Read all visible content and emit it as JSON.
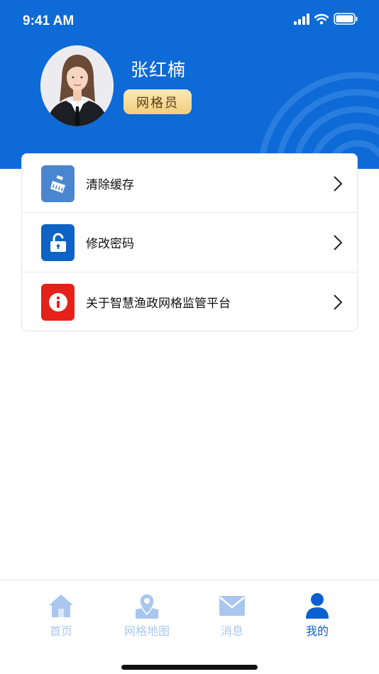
{
  "status_bar": {
    "time": "9:41 AM"
  },
  "profile": {
    "name": "张红楠",
    "role": "网格员"
  },
  "menu": {
    "items": [
      {
        "label": "清除缓存",
        "icon": "broom-icon",
        "color": "#4a86d0"
      },
      {
        "label": "修改密码",
        "icon": "lock-icon",
        "color": "#0e63c4"
      },
      {
        "label": "关于智慧渔政网格监管平台",
        "icon": "info-icon",
        "color": "#e5221a"
      }
    ]
  },
  "tabbar": {
    "tabs": [
      {
        "label": "首页",
        "icon": "home-icon",
        "active": false
      },
      {
        "label": "网格地图",
        "icon": "map-pin-icon",
        "active": false
      },
      {
        "label": "消息",
        "icon": "mail-icon",
        "active": false
      },
      {
        "label": "我的",
        "icon": "person-icon",
        "active": true
      }
    ],
    "active_color": "#0d5fd0",
    "inactive_color": "#a9c7ee"
  },
  "colors": {
    "brand": "#0d6ad6",
    "badge_bg": "#f6dc95"
  }
}
